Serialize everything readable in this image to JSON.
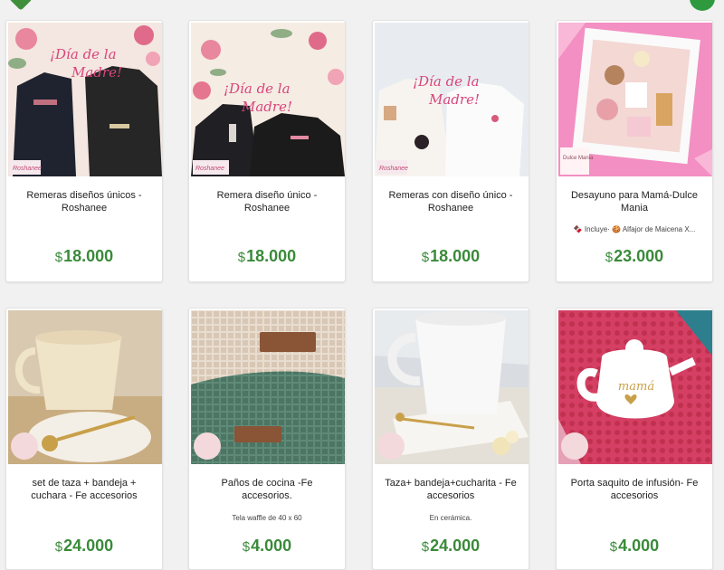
{
  "products": [
    {
      "title": "Remeras diseños únicos - Roshanee",
      "description": "",
      "currency": "$",
      "price": "18.000"
    },
    {
      "title": "Remera diseño único - Roshanee",
      "description": "",
      "currency": "$",
      "price": "18.000"
    },
    {
      "title": "Remeras con diseño único - Roshanee",
      "description": "",
      "currency": "$",
      "price": "18.000"
    },
    {
      "title": "Desayuno para Mamá-Dulce Mania",
      "description": "🍫 Incluye· 🍪 Alfajor de Maicena X...",
      "currency": "$",
      "price": "23.000"
    },
    {
      "title": "set de taza + bandeja + cuchara - Fe accesorios",
      "description": "",
      "currency": "$",
      "price": "24.000"
    },
    {
      "title": "Paños de cocina -Fe accesorios.",
      "description": "Tela waffle de 40 x 60",
      "currency": "$",
      "price": "4.000"
    },
    {
      "title": "Taza+ bandeja+cucharita - Fe accesorios",
      "description": "En cerámica.",
      "currency": "$",
      "price": "24.000"
    },
    {
      "title": "Porta saquito de infusión- Fe accesorios",
      "description": "",
      "currency": "$",
      "price": "4.000"
    }
  ],
  "image_texts": {
    "dia_line1": "¡Día de la",
    "dia_line2": "Madre!",
    "brand_roshanee": "Roshanee",
    "brand_dulce": "Dulce Mania",
    "mama": "mamá"
  },
  "colors": {
    "price": "#3a8a3a",
    "accent": "#2e9a3d"
  },
  "icons": [
    "favorite-icon",
    "cart-icon"
  ]
}
